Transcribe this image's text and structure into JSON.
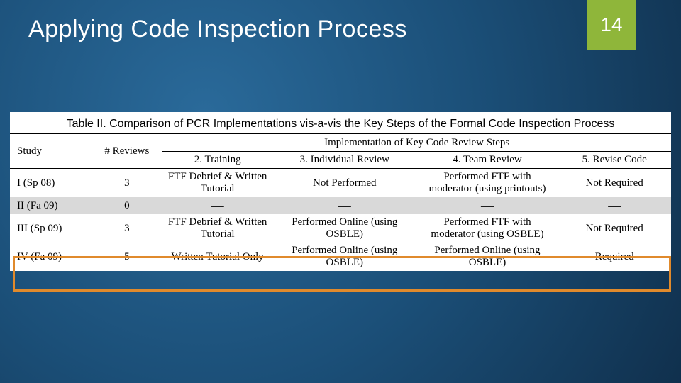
{
  "slide": {
    "title": "Applying Code Inspection Process",
    "page_number": "14"
  },
  "table": {
    "caption": "Table II. Comparison of PCR Implementations vis-a-vis the Key Steps of the Formal Code Inspection Process",
    "headers": {
      "study": "Study",
      "reviews": "# Reviews",
      "impl_group": "Implementation of Key Code Review Steps",
      "training": "2. Training",
      "individual": "3. Individual Review",
      "team": "4. Team Review",
      "revise": "5. Revise Code"
    },
    "rows": [
      {
        "study": "I (Sp 08)",
        "reviews": "3",
        "training": "FTF Debrief & Written Tutorial",
        "individual": "Not Performed",
        "team": "Performed FTF with moderator (using printouts)",
        "revise": "Not Required"
      },
      {
        "study": "II (Fa 09)",
        "reviews": "0",
        "training": "—",
        "individual": "—",
        "team": "—",
        "revise": "—"
      },
      {
        "study": "III (Sp 09)",
        "reviews": "3",
        "training": "FTF Debrief & Written Tutorial",
        "individual": "Performed Online (using OSBLE)",
        "team": "Performed FTF with moderator (using OSBLE)",
        "revise": "Not Required"
      },
      {
        "study": "IV (Fa 09)",
        "reviews": "5",
        "training": "Written Tutorial Only",
        "individual": "Performed Online (using OSBLE)",
        "team": "Performed Online (using OSBLE)",
        "revise": "Required"
      }
    ]
  }
}
